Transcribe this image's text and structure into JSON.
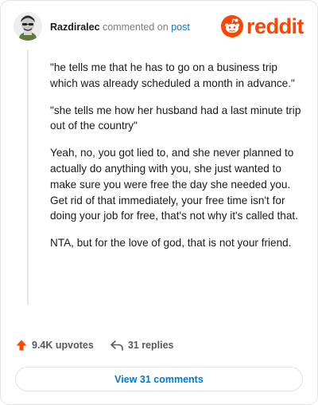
{
  "comment": {
    "username": "Razdiralec",
    "action_text": "commented on",
    "link_text": "post",
    "paragraphs": [
      "\"he tells me that he has to go on a business trip which was already scheduled a month in advance.\"",
      "\"she tells me how her husband had a last minute trip out of the country\"",
      "Yeah, no, you got lied to, and she never planned to actually do anything with you, she just wanted to make sure you were free the day she needed you. Get rid of that immediately, your free time isn't for doing your job for free, that's not why it's called that.",
      "NTA, but for the love of god, that is not your friend."
    ]
  },
  "brand": {
    "name": "reddit",
    "color": "#ff4500",
    "icon": "reddit-snoo-icon"
  },
  "actions": {
    "upvotes": "9.4K upvotes",
    "replies": "31 replies"
  },
  "footer": {
    "view_comments": "View 31 comments"
  },
  "colors": {
    "link": "#0079d3",
    "text": "#1a1a1b",
    "muted": "#7c7c7c",
    "upvote": "#ff4500"
  }
}
